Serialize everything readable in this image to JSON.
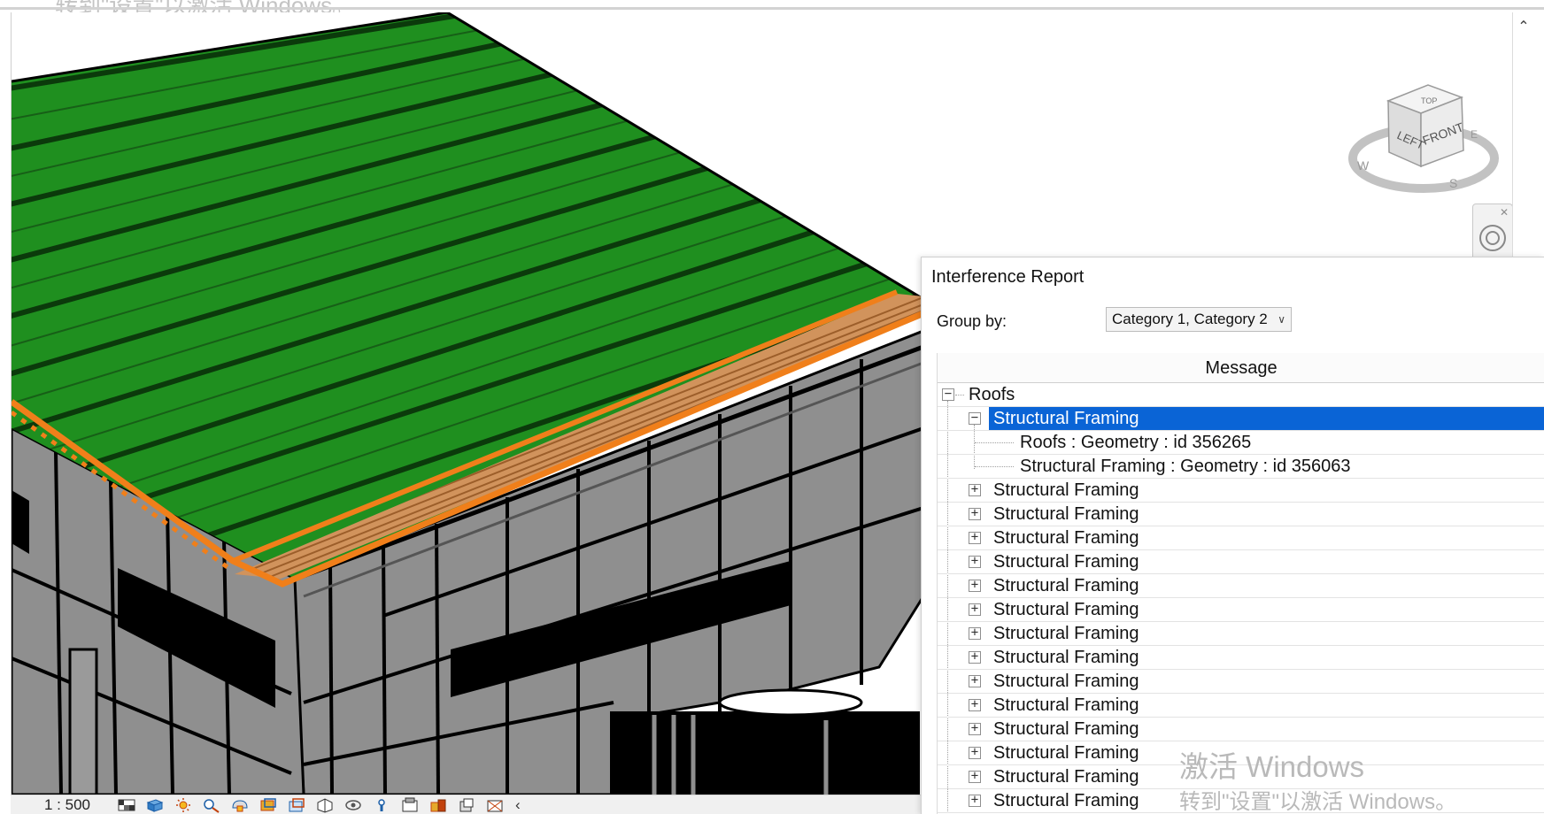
{
  "watermark": {
    "top_text": "转到\"设置\"以激活 Windows。",
    "line1": "激活 Windows",
    "line2": "转到\"设置\"以激活 Windows。"
  },
  "viewcube": {
    "top": "TOP",
    "left": "LEFT",
    "front": "FRONT",
    "compass": [
      "W",
      "S",
      "E"
    ]
  },
  "viewport": {
    "scroll_up_icon": "chevron-up-icon",
    "nav_close_icon": "close-icon",
    "nav_icon": "steering-wheel-icon"
  },
  "status_bar": {
    "scale": "1 : 500",
    "icons": [
      "detail-level-icon",
      "visual-style-icon",
      "sun-path-icon",
      "shadows-icon",
      "render-icon",
      "crop-view-icon",
      "show-crop-icon",
      "temporary-hide-icon",
      "reveal-hidden-icon",
      "lock-3d-icon",
      "temporary-view-properties-icon",
      "hide-analytical-icon",
      "highlight-displacement-icon",
      "reveal-constraints-icon"
    ],
    "expand_icon": "chevron-left-icon",
    "expand_text": "‹"
  },
  "report": {
    "title": "Interference Report",
    "group_by_label": "Group by:",
    "group_by_value": "Category 1, Category 2",
    "column_header": "Message",
    "tree": {
      "root": {
        "label": "Roofs",
        "expanded": true
      },
      "selected": {
        "label": "Structural Framing",
        "expanded": true
      },
      "children": [
        "Roofs : Geometry : id 356265",
        "Structural Framing : Geometry : id 356063"
      ],
      "collapsed": [
        "Structural Framing",
        "Structural Framing",
        "Structural Framing",
        "Structural Framing",
        "Structural Framing",
        "Structural Framing",
        "Structural Framing",
        "Structural Framing",
        "Structural Framing",
        "Structural Framing",
        "Structural Framing",
        "Structural Framing",
        "Structural Framing",
        "Structural Framing"
      ]
    },
    "toggle_expanded": "−",
    "toggle_collapsed": "+"
  },
  "colors": {
    "roof_green": "#1f8f1f",
    "roof_seam": "#0b3a0b",
    "interference_orange": "#f07f1a",
    "interference_tan": "#d1935c",
    "wall_grey": "#8f8f8f",
    "selection_blue": "#0a64d6"
  }
}
